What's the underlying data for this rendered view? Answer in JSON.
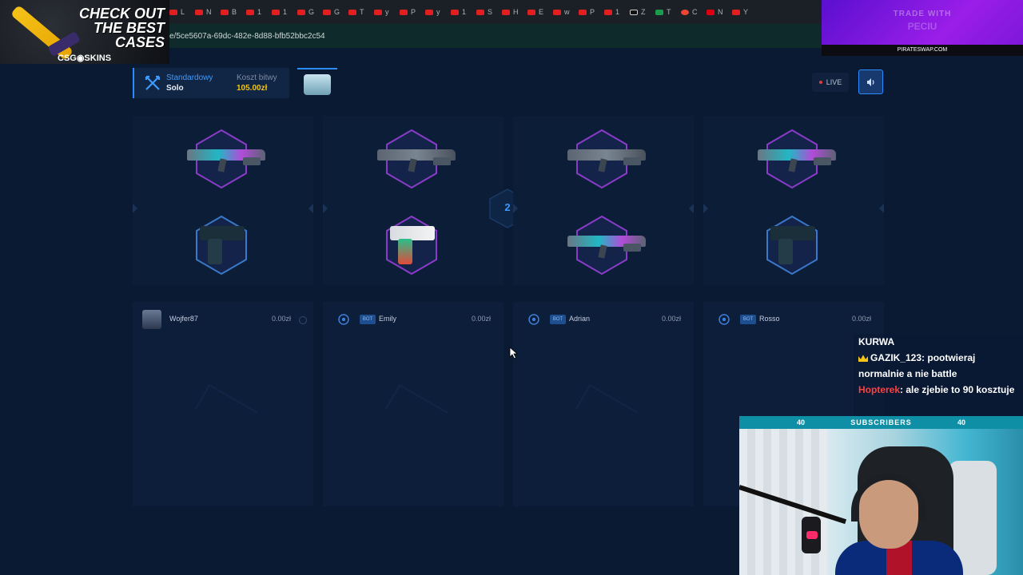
{
  "browser": {
    "tabs": [
      "L",
      "N",
      "B",
      "1",
      "1",
      "G",
      "G",
      "T",
      "y",
      "P",
      "y",
      "1",
      "S",
      "H",
      "E",
      "w",
      "P",
      "1",
      "Z",
      "T",
      "C",
      "N",
      "Y"
    ],
    "url": "e/5ce5607a-69dc-482e-8d88-bfb52bbc2c54"
  },
  "overlays": {
    "promo_line1": "CHECK OUT",
    "promo_line2": "THE BEST",
    "promo_line3": "CASES",
    "promo_brand": "CSG◉SKINS",
    "sponsor_title": "TRADE WITH",
    "sponsor_sub": "PECIU",
    "sponsor_domain": "PIRATESWAP.COM"
  },
  "battle": {
    "mode_name": "Standardowy",
    "mode_type": "Solo",
    "cost_label": "Koszt bitwy",
    "cost_value": "105.00zł",
    "live_label": "LIVE",
    "round": "2"
  },
  "players": [
    {
      "name": "Wojfer87",
      "value": "0.00zł",
      "bot": false
    },
    {
      "name": "Emily",
      "value": "0.00zł",
      "bot": true,
      "tag": "BOT"
    },
    {
      "name": "Adrian",
      "value": "0.00zł",
      "bot": true,
      "tag": "BOT"
    },
    {
      "name": "Rosso",
      "value": "0.00zł",
      "bot": true,
      "tag": "BOT"
    }
  ],
  "chat": {
    "line0": "KURWA",
    "line1_user": "GAZIK_123",
    "line1_msg": ": pootwieraj normalnie a nie battle",
    "line2_user": "Hopterek",
    "line2_msg": ": ale zjebie to 90 kosztuje"
  },
  "webcam": {
    "subs_left": "40",
    "subs_label": "SUBSCRIBERS",
    "subs_right": "40"
  },
  "colors": {
    "background": "#0b1a33",
    "accent_blue": "#2a8cff",
    "price_gold": "#f1c40f",
    "hex_purple": "#8a3cc8",
    "hex_blue": "#3a78c8",
    "chat_red": "#ff4040",
    "sponsor_purple": "#8a1ae0"
  }
}
